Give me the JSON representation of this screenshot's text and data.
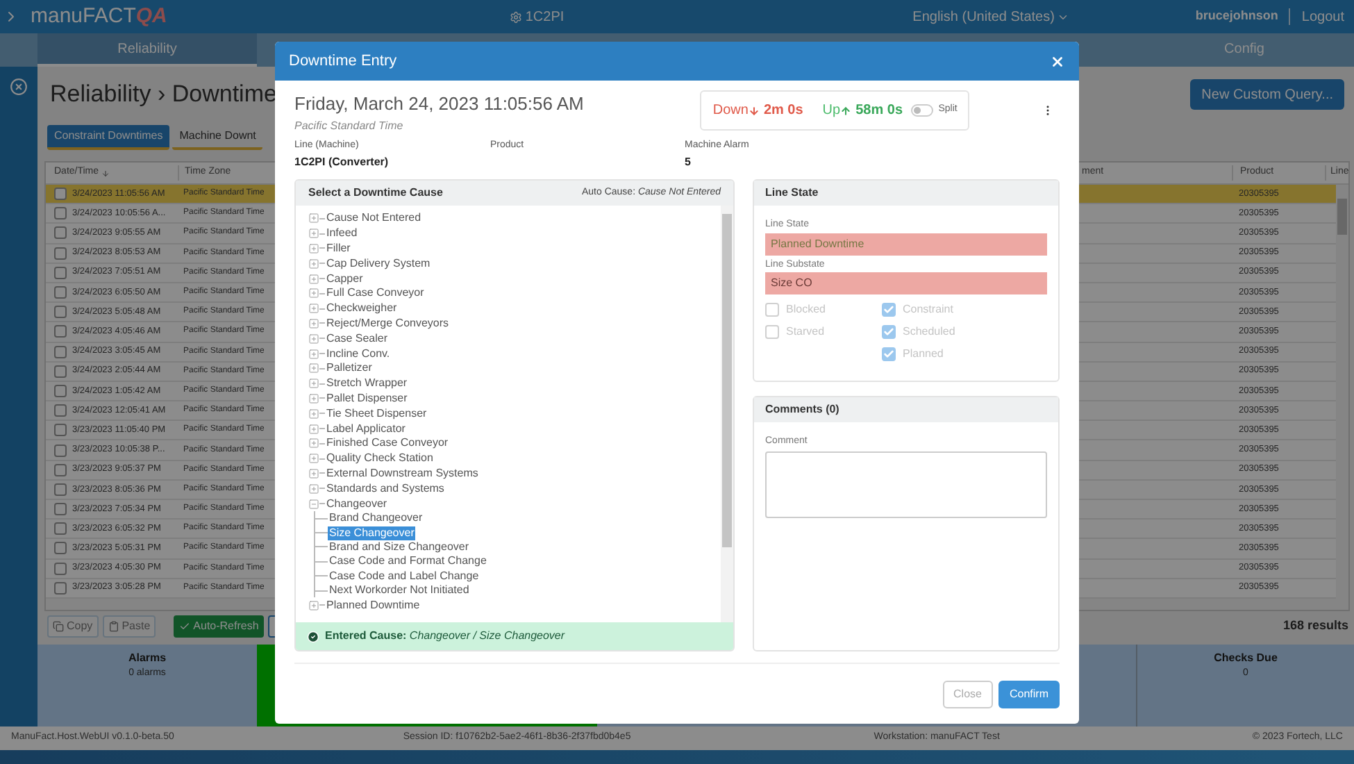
{
  "top_bar": {
    "brand": "manuFACT",
    "brand_badge": "QA",
    "site": "1C2PI",
    "language": "English (United States)",
    "user": "brucejohnson",
    "logout": "Logout"
  },
  "nav": [
    {
      "label": "Reliability",
      "selected": true
    },
    {
      "label": "Config",
      "selected": false
    }
  ],
  "page": {
    "title": "Reliability › Downtime",
    "new_query": "New Custom Query...",
    "tabs": [
      {
        "label": "Constraint Downtimes",
        "selected": true
      },
      {
        "label": "Machine Downt",
        "selected": false
      }
    ],
    "table": {
      "columns": [
        "Date/Time",
        "Time Zone",
        "ment",
        "Product",
        "Line"
      ],
      "rows": [
        {
          "datetime": "3/24/2023 11:05:56 AM",
          "zone": "Pacific Standard Time",
          "product": "20305395",
          "selected": true,
          "checked": false
        },
        {
          "datetime": "3/24/2023 10:05:56 A...",
          "zone": "Pacific Standard Time",
          "product": "20305395",
          "selected": false,
          "checked": false
        },
        {
          "datetime": "3/24/2023 9:05:55 AM",
          "zone": "Pacific Standard Time",
          "product": "20305395",
          "selected": false,
          "checked": false
        },
        {
          "datetime": "3/24/2023 8:05:53 AM",
          "zone": "Pacific Standard Time",
          "product": "20305395",
          "selected": false,
          "checked": false
        },
        {
          "datetime": "3/24/2023 7:05:51 AM",
          "zone": "Pacific Standard Time",
          "product": "20305395",
          "selected": false,
          "checked": false
        },
        {
          "datetime": "3/24/2023 6:05:50 AM",
          "zone": "Pacific Standard Time",
          "product": "20305395",
          "selected": false,
          "checked": false
        },
        {
          "datetime": "3/24/2023 5:05:48 AM",
          "zone": "Pacific Standard Time",
          "product": "20305395",
          "selected": false,
          "checked": false
        },
        {
          "datetime": "3/24/2023 4:05:46 AM",
          "zone": "Pacific Standard Time",
          "product": "20305395",
          "selected": false,
          "checked": false
        },
        {
          "datetime": "3/24/2023 3:05:45 AM",
          "zone": "Pacific Standard Time",
          "product": "20305395",
          "selected": false,
          "checked": false
        },
        {
          "datetime": "3/24/2023 2:05:44 AM",
          "zone": "Pacific Standard Time",
          "product": "20305395",
          "selected": false,
          "checked": false
        },
        {
          "datetime": "3/24/2023 1:05:42 AM",
          "zone": "Pacific Standard Time",
          "product": "20305395",
          "selected": false,
          "checked": false
        },
        {
          "datetime": "3/24/2023 12:05:41 AM",
          "zone": "Pacific Standard Time",
          "product": "20305395",
          "selected": false,
          "checked": false
        },
        {
          "datetime": "3/23/2023 11:05:40 PM",
          "zone": "Pacific Standard Time",
          "product": "20305395",
          "selected": false,
          "checked": false
        },
        {
          "datetime": "3/23/2023 10:05:38 P...",
          "zone": "Pacific Standard Time",
          "product": "20305395",
          "selected": false,
          "checked": false
        },
        {
          "datetime": "3/23/2023 9:05:37 PM",
          "zone": "Pacific Standard Time",
          "product": "20305395",
          "selected": false,
          "checked": false
        },
        {
          "datetime": "3/23/2023 8:05:36 PM",
          "zone": "Pacific Standard Time",
          "product": "20305395",
          "selected": false,
          "checked": false
        },
        {
          "datetime": "3/23/2023 7:05:34 PM",
          "zone": "Pacific Standard Time",
          "product": "20305395",
          "selected": false,
          "checked": false
        },
        {
          "datetime": "3/23/2023 6:05:32 PM",
          "zone": "Pacific Standard Time",
          "product": "20305395",
          "selected": false,
          "checked": false
        },
        {
          "datetime": "3/23/2023 5:05:31 PM",
          "zone": "Pacific Standard Time",
          "product": "20305395",
          "selected": false,
          "checked": false
        },
        {
          "datetime": "3/23/2023 4:05:30 PM",
          "zone": "Pacific Standard Time",
          "product": "20305395",
          "selected": false,
          "checked": false
        },
        {
          "datetime": "3/23/2023 3:05:28 PM",
          "zone": "Pacific Standard Time",
          "product": "20305395",
          "selected": false,
          "checked": false
        }
      ]
    },
    "actions": [
      {
        "label": "Copy",
        "kind": "copy",
        "disabled": true
      },
      {
        "label": "Paste",
        "kind": "paste",
        "disabled": true
      },
      {
        "label": "Auto-Refresh",
        "kind": "toggle",
        "disabled": false
      }
    ],
    "results": "168 results",
    "alarms": {
      "title": "Alarms",
      "value": "0 alarms"
    },
    "checks": {
      "title": "Checks Due",
      "value": "0"
    }
  },
  "footer": {
    "version": "ManuFact.Host.WebUI v0.1.0-beta.50",
    "session": "Session ID: f10762b2-5ae2-46f1-8b36-2f37fbd0b4e5",
    "workstation": "Workstation: manuFACT Test",
    "copyright": "© 2023 Fortech, LLC"
  },
  "dialog": {
    "title": "Downtime Entry",
    "date": "Friday, March 24, 2023 11:05:56 AM",
    "zone": "Pacific Standard Time",
    "down": {
      "label": "Down",
      "value": "2m 0s"
    },
    "up": {
      "label": "Up",
      "value": "58m 0s"
    },
    "split": {
      "label": "Split",
      "on": false
    },
    "fields": [
      {
        "label": "Line (Machine)",
        "value": "1C2PI (Converter)"
      },
      {
        "label": "Product"
      },
      {
        "label": "Machine Alarm",
        "value": "5"
      }
    ],
    "cause_panel": {
      "title": "Select a Downtime Cause",
      "auto": "Auto Cause: *Cause Not Entered*",
      "tree": [
        {
          "label": "Cause Not Entered",
          "expanded": false,
          "selected": false
        },
        {
          "label": "Infeed",
          "expanded": false,
          "selected": false
        },
        {
          "label": "Filler",
          "expanded": false,
          "selected": false
        },
        {
          "label": "Cap Delivery System",
          "expanded": false,
          "selected": false
        },
        {
          "label": "Capper",
          "expanded": false,
          "selected": false
        },
        {
          "label": "Full Case Conveyor",
          "expanded": false,
          "selected": false
        },
        {
          "label": "Checkweigher",
          "expanded": false,
          "selected": false
        },
        {
          "label": "Reject/Merge Conveyors",
          "expanded": false,
          "selected": false
        },
        {
          "label": "Case Sealer",
          "expanded": false,
          "selected": false
        },
        {
          "label": "Incline Conv.",
          "expanded": false,
          "selected": false
        },
        {
          "label": "Palletizer",
          "expanded": false,
          "selected": false
        },
        {
          "label": "Stretch Wrapper",
          "expanded": false,
          "selected": false
        },
        {
          "label": "Pallet Dispenser",
          "expanded": false,
          "selected": false
        },
        {
          "label": "Tie Sheet Dispenser",
          "expanded": false,
          "selected": false
        },
        {
          "label": "Label Applicator",
          "expanded": false,
          "selected": false
        },
        {
          "label": "Finished Case Conveyor",
          "expanded": false,
          "selected": false
        },
        {
          "label": "Quality Check Station",
          "expanded": false,
          "selected": false
        },
        {
          "label": "External Downstream Systems",
          "expanded": false,
          "selected": false
        },
        {
          "label": "Standards and Systems",
          "expanded": false,
          "selected": false
        },
        {
          "label": "Changeover",
          "expanded": true,
          "selected": false,
          "children": [
            {
              "label": "Brand Changeover",
              "selected": false
            },
            {
              "label": "Size Changeover",
              "selected": true
            },
            {
              "label": "Brand and Size Changeover",
              "selected": false
            },
            {
              "label": "Case Code and Format Change",
              "selected": false
            },
            {
              "label": "Case Code and Label Change",
              "selected": false
            },
            {
              "label": "Next Workorder Not Initiated",
              "selected": false
            }
          ]
        },
        {
          "label": "Planned Downtime",
          "expanded": false,
          "selected": false
        }
      ],
      "entered": "**Entered Cause:** *Changeover / Size Changeover*"
    },
    "line_state": {
      "title": "Line State",
      "state_label": "Line State",
      "state": "Planned Downtime",
      "substate_label": "Line Substate",
      "substate": "Size CO",
      "flags_left": [
        {
          "label": "Blocked",
          "checked": false,
          "disabled": true
        },
        {
          "label": "Starved",
          "checked": false,
          "disabled": true
        }
      ],
      "flags_right": [
        {
          "label": "Constraint",
          "checked": true,
          "disabled": true
        },
        {
          "label": "Scheduled",
          "checked": true,
          "disabled": true
        },
        {
          "label": "Planned",
          "checked": true,
          "disabled": true
        }
      ]
    },
    "comments": {
      "title": "Comments (0)",
      "label": "Comment"
    },
    "buttons": [
      {
        "label": "Close",
        "kind": "secondary"
      },
      {
        "label": "Confirm",
        "kind": "primary"
      }
    ]
  }
}
